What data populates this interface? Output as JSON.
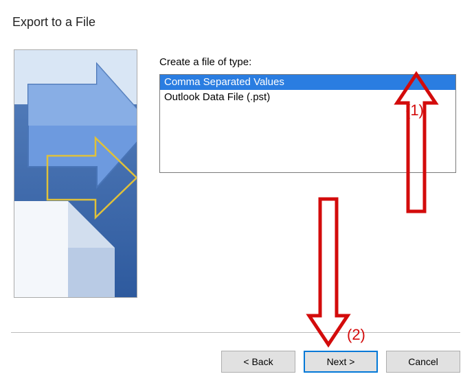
{
  "dialog": {
    "title": "Export to a File",
    "prompt_label": "Create a file of type:"
  },
  "file_types": [
    {
      "label": "Comma Separated Values",
      "selected": true
    },
    {
      "label": "Outlook Data File (.pst)",
      "selected": false
    }
  ],
  "buttons": {
    "back": "< Back",
    "next": "Next >",
    "cancel": "Cancel"
  },
  "annotations": {
    "step1": "(1)",
    "step2": "(2)"
  },
  "colors": {
    "selection_bg": "#2a7de1",
    "selection_fg": "#ffffff",
    "annotation": "#d30b0b",
    "primary_border": "#0078d7"
  }
}
